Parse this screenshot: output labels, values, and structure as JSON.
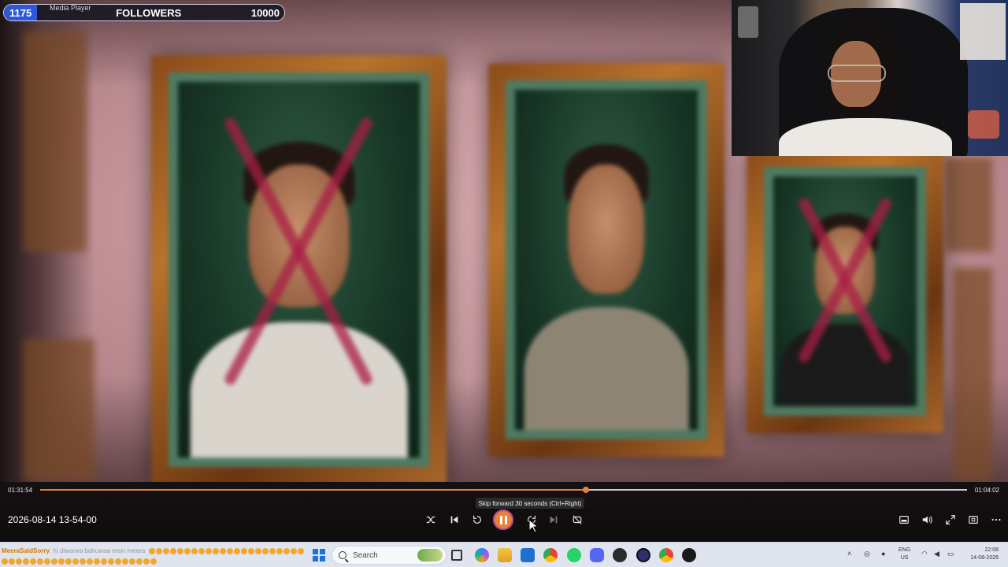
{
  "overlay": {
    "followers_count": "1175",
    "app_name": "Media Player",
    "followers_label": "FOLLOWERS",
    "followers_goal": "10000"
  },
  "player": {
    "time_elapsed": "01:31:54",
    "time_total": "01:04:02",
    "progress": 0.589,
    "tooltip": "Skip forward 30 seconds (Ctrl+Right)",
    "title": "2026-08-14 13-54-00",
    "accent_color": "#e8823a",
    "controls_center": [
      "shuffle-icon",
      "previous-icon",
      "skip-back-icon",
      "pause-icon",
      "skip-forward-icon",
      "next-icon",
      "repeat-off-icon"
    ],
    "controls_right": [
      "miniplayer-icon",
      "volume-icon",
      "fullscreen-icon",
      "cast-icon",
      "more-icon"
    ]
  },
  "taskbar": {
    "chat_user": "MeeraSaidSorry",
    "chat_message": ": hi diwarwa bahuwaa main meera",
    "search_placeholder": "Search",
    "lang_line1": "ENG",
    "lang_line2": "US",
    "time": "22:08",
    "date": "14-08-2026",
    "pinned_icons": [
      "task-view-icon",
      "copilot-icon",
      "file-explorer-icon",
      "store-icon",
      "chrome-icon",
      "whatsapp-icon",
      "discord-icon",
      "app-icon",
      "obs-icon",
      "chrome-alt-icon",
      "media-player-icon"
    ],
    "tray_icons": [
      "chevron-up-icon",
      "network-icon",
      "mic-icon",
      "wifi-icon",
      "speaker-icon",
      "battery-icon"
    ]
  }
}
